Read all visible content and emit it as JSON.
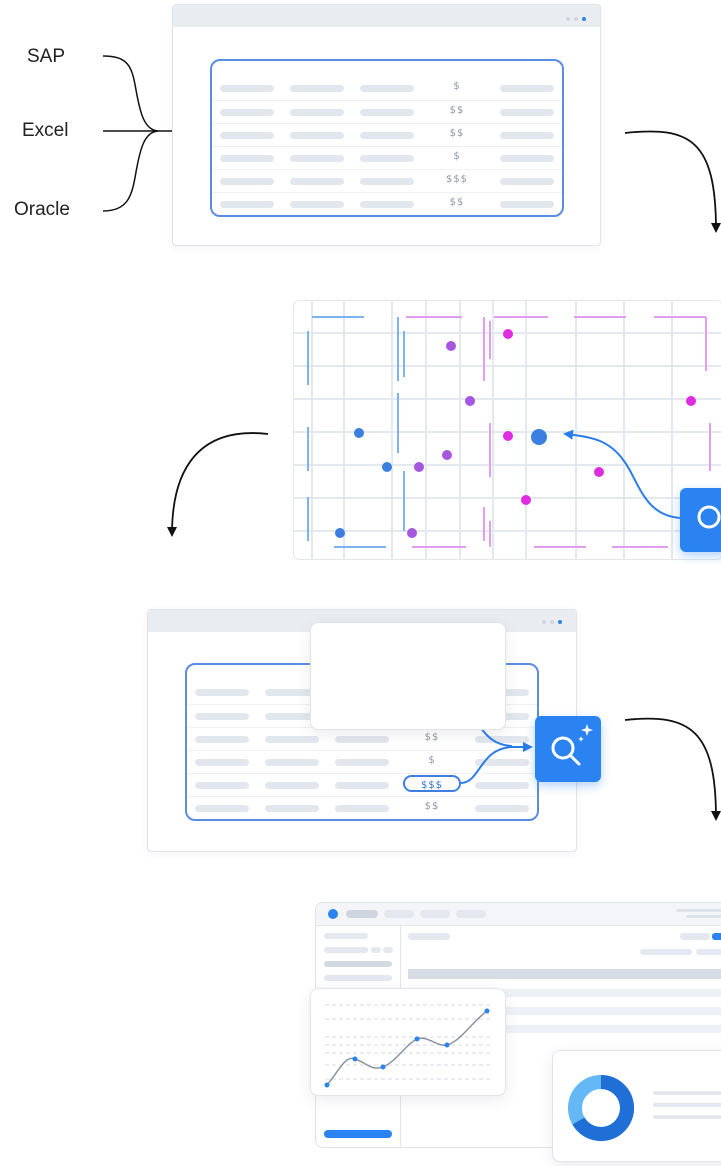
{
  "sources": [
    "SAP",
    "Excel",
    "Oracle"
  ],
  "table1": {
    "money": [
      "$",
      "$$",
      "$$",
      "$",
      "$$$",
      "$$"
    ]
  },
  "table2": {
    "money": [
      "$",
      "$$$",
      "$$",
      "$",
      "$$$",
      "$$"
    ],
    "highlighted_rows": [
      1,
      4
    ]
  },
  "colors": {
    "accent_blue": "#2a83f0",
    "table_border": "#5a8de3",
    "point_purple": "#a657e0",
    "point_magenta": "#e02ce0",
    "point_blue": "#3b7fe0",
    "donut_dark": "#1f6fd6",
    "donut_light": "#63b8f5"
  },
  "icons": {
    "search_sparkle": "search-sparkle-icon",
    "search": "search-icon"
  }
}
